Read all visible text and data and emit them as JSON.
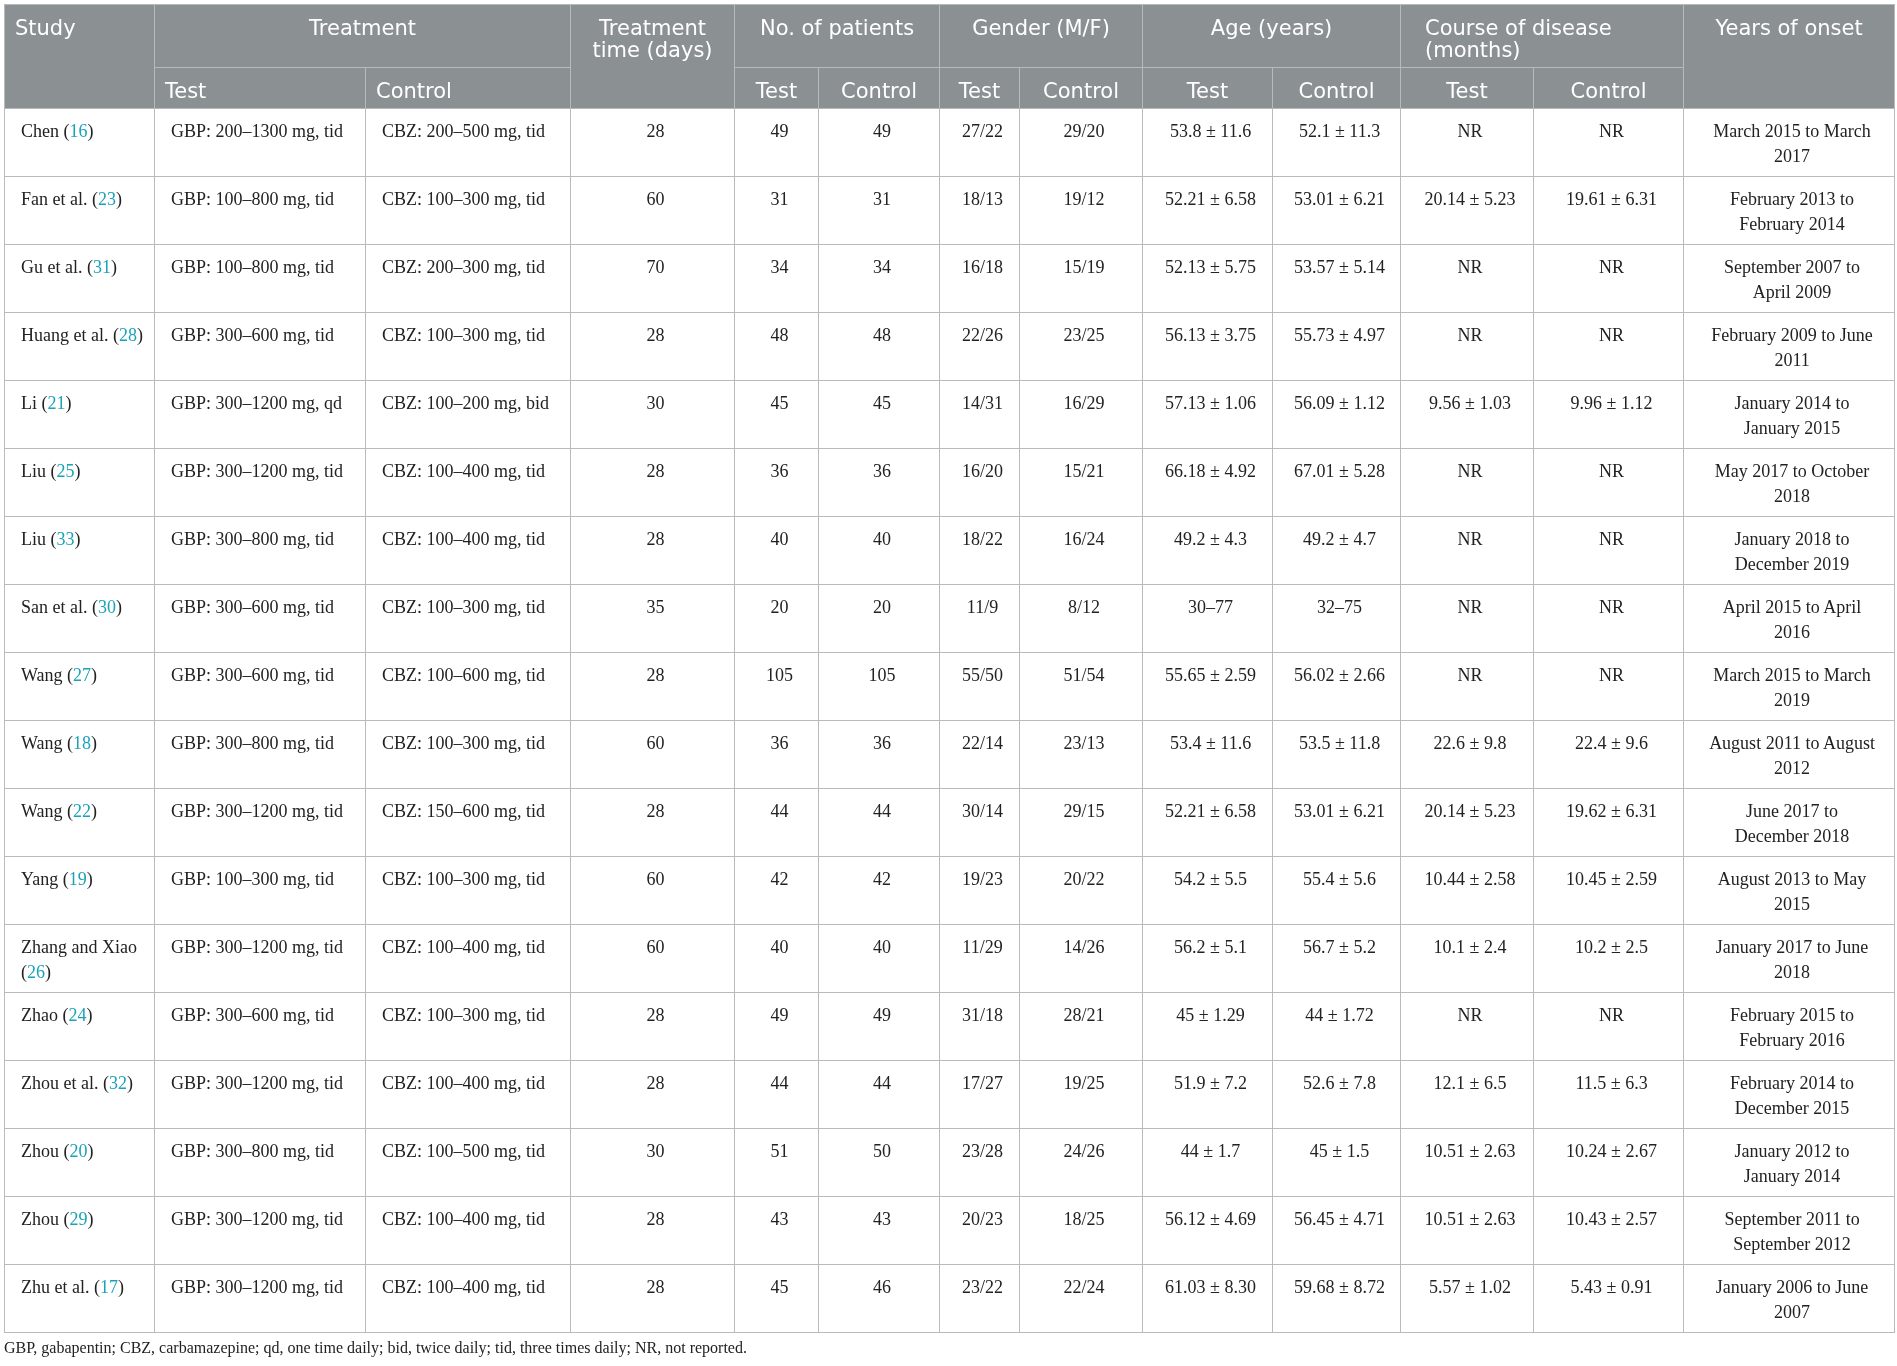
{
  "table": {
    "header_groups": [
      {
        "label": "Study"
      },
      {
        "label": "Treatment",
        "subs": [
          "Test",
          "Control"
        ]
      },
      {
        "label": "Treatment time (days)"
      },
      {
        "label": "No. of patients",
        "subs": [
          "Test",
          "Control"
        ]
      },
      {
        "label": "Gender (M/F)",
        "subs": [
          "Test",
          "Control"
        ]
      },
      {
        "label": "Age (years)",
        "subs": [
          "Test",
          "Control"
        ]
      },
      {
        "label": "Course of disease (months)",
        "subs": [
          "Test",
          "Control"
        ]
      },
      {
        "label": "Years of onset"
      }
    ],
    "rows": [
      {
        "author": "Chen (",
        "ref": "16",
        "tail": ")",
        "cells": [
          "GBP: 200–1300 mg, tid",
          "CBZ: 200–500 mg, tid",
          "28",
          "49",
          "49",
          "27/22",
          "29/20",
          "53.8 ± 11.6",
          "52.1 ± 11.3",
          "NR",
          "NR",
          "March 2015 to March 2017"
        ]
      },
      {
        "author": "Fan et al. (",
        "ref": "23",
        "tail": ")",
        "cells": [
          "GBP: 100–800 mg, tid",
          "CBZ: 100–300 mg, tid",
          "60",
          "31",
          "31",
          "18/13",
          "19/12",
          "52.21 ± 6.58",
          "53.01 ± 6.21",
          "20.14 ± 5.23",
          "19.61 ± 6.31",
          "February 2013 to February 2014"
        ]
      },
      {
        "author": "Gu et al. (",
        "ref": "31",
        "tail": ")",
        "cells": [
          "GBP: 100–800 mg, tid",
          "CBZ: 200–300 mg, tid",
          "70",
          "34",
          "34",
          "16/18",
          "15/19",
          "52.13 ± 5.75",
          "53.57 ± 5.14",
          "NR",
          "NR",
          "September 2007 to April 2009"
        ]
      },
      {
        "author": "Huang et al. (",
        "ref": "28",
        "tail": ")",
        "cells": [
          "GBP: 300–600 mg, tid",
          "CBZ: 100–300 mg, tid",
          "28",
          "48",
          "48",
          "22/26",
          "23/25",
          "56.13 ± 3.75",
          "55.73 ± 4.97",
          "NR",
          "NR",
          "February 2009 to June 2011"
        ]
      },
      {
        "author": "Li (",
        "ref": "21",
        "tail": ")",
        "cells": [
          "GBP: 300–1200 mg, qd",
          "CBZ: 100–200 mg, bid",
          "30",
          "45",
          "45",
          "14/31",
          "16/29",
          "57.13 ± 1.06",
          "56.09 ± 1.12",
          "9.56 ± 1.03",
          "9.96 ± 1.12",
          "January 2014 to January 2015"
        ]
      },
      {
        "author": "Liu (",
        "ref": "25",
        "tail": ")",
        "cells": [
          "GBP: 300–1200 mg, tid",
          "CBZ: 100–400 mg, tid",
          "28",
          "36",
          "36",
          "16/20",
          "15/21",
          "66.18 ± 4.92",
          "67.01 ± 5.28",
          "NR",
          "NR",
          "May 2017 to October 2018"
        ]
      },
      {
        "author": "Liu (",
        "ref": "33",
        "tail": ")",
        "cells": [
          "GBP: 300–800 mg, tid",
          "CBZ: 100–400 mg, tid",
          "28",
          "40",
          "40",
          "18/22",
          "16/24",
          "49.2 ± 4.3",
          "49.2 ± 4.7",
          "NR",
          "NR",
          "January 2018 to December 2019"
        ]
      },
      {
        "author": "San et al. (",
        "ref": "30",
        "tail": ")",
        "cells": [
          "GBP: 300–600 mg, tid",
          "CBZ: 100–300 mg, tid",
          "35",
          "20",
          "20",
          "11/9",
          "8/12",
          "30–77",
          "32–75",
          "NR",
          "NR",
          "April 2015 to April 2016"
        ]
      },
      {
        "author": "Wang (",
        "ref": "27",
        "tail": ")",
        "cells": [
          "GBP: 300–600 mg, tid",
          "CBZ: 100–600 mg, tid",
          "28",
          "105",
          "105",
          "55/50",
          "51/54",
          "55.65 ± 2.59",
          "56.02 ± 2.66",
          "NR",
          "NR",
          "March 2015 to March 2019"
        ]
      },
      {
        "author": "Wang (",
        "ref": "18",
        "tail": ")",
        "cells": [
          "GBP: 300–800 mg, tid",
          "CBZ: 100–300 mg, tid",
          "60",
          "36",
          "36",
          "22/14",
          "23/13",
          "53.4 ± 11.6",
          "53.5 ± 11.8",
          "22.6 ± 9.8",
          "22.4 ± 9.6",
          "August 2011 to August 2012"
        ]
      },
      {
        "author": "Wang (",
        "ref": "22",
        "tail": ")",
        "cells": [
          "GBP: 300–1200 mg, tid",
          "CBZ: 150–600 mg, tid",
          "28",
          "44",
          "44",
          "30/14",
          "29/15",
          "52.21 ± 6.58",
          "53.01 ± 6.21",
          "20.14 ± 5.23",
          "19.62 ± 6.31",
          "June 2017 to December 2018"
        ]
      },
      {
        "author": "Yang (",
        "ref": "19",
        "tail": ")",
        "cells": [
          "GBP: 100–300 mg, tid",
          "CBZ: 100–300 mg, tid",
          "60",
          "42",
          "42",
          "19/23",
          "20/22",
          "54.2 ± 5.5",
          "55.4 ± 5.6",
          "10.44 ± 2.58",
          "10.45 ± 2.59",
          "August 2013 to May 2015"
        ]
      },
      {
        "author": "Zhang and Xiao (",
        "ref": "26",
        "tail": ")",
        "cells": [
          "GBP: 300–1200 mg, tid",
          "CBZ: 100–400 mg, tid",
          "60",
          "40",
          "40",
          "11/29",
          "14/26",
          "56.2 ± 5.1",
          "56.7 ± 5.2",
          "10.1 ± 2.4",
          "10.2 ± 2.5",
          "January 2017 to June 2018"
        ]
      },
      {
        "author": "Zhao (",
        "ref": "24",
        "tail": ")",
        "cells": [
          "GBP: 300–600 mg, tid",
          "CBZ: 100–300 mg, tid",
          "28",
          "49",
          "49",
          "31/18",
          "28/21",
          "45 ± 1.29",
          "44 ± 1.72",
          "NR",
          "NR",
          "February 2015 to February 2016"
        ]
      },
      {
        "author": "Zhou et al. (",
        "ref": "32",
        "tail": ")",
        "cells": [
          "GBP: 300–1200 mg, tid",
          "CBZ: 100–400 mg, tid",
          "28",
          "44",
          "44",
          "17/27",
          "19/25",
          "51.9 ± 7.2",
          "52.6 ± 7.8",
          "12.1 ± 6.5",
          "11.5 ± 6.3",
          "February 2014 to December 2015"
        ]
      },
      {
        "author": "Zhou (",
        "ref": "20",
        "tail": ")",
        "cells": [
          "GBP: 300–800 mg, tid",
          "CBZ: 100–500 mg, tid",
          "30",
          "51",
          "50",
          "23/28",
          "24/26",
          "44 ± 1.7",
          "45 ± 1.5",
          "10.51 ± 2.63",
          "10.24 ± 2.67",
          "January 2012 to January 2014"
        ]
      },
      {
        "author": "Zhou (",
        "ref": "29",
        "tail": ")",
        "cells": [
          "GBP: 300–1200 mg, tid",
          "CBZ: 100–400 mg, tid",
          "28",
          "43",
          "43",
          "20/23",
          "18/25",
          "56.12 ± 4.69",
          "56.45 ± 4.71",
          "10.51 ± 2.63",
          "10.43 ± 2.57",
          "September 2011 to September 2012"
        ]
      },
      {
        "author": "Zhu et al. (",
        "ref": "17",
        "tail": ")",
        "cells": [
          "GBP: 300–1200 mg, tid",
          "CBZ: 100–400 mg, tid",
          "28",
          "45",
          "46",
          "23/22",
          "22/24",
          "61.03 ± 8.30",
          "59.68 ± 8.72",
          "5.57 ± 1.02",
          "5.43 ± 0.91",
          "January 2006 to June 2007"
        ]
      }
    ]
  },
  "footnote": "GBP, gabapentin; CBZ, carbamazepine; qd, one time daily; bid, twice daily; tid, three times daily; NR, not reported."
}
